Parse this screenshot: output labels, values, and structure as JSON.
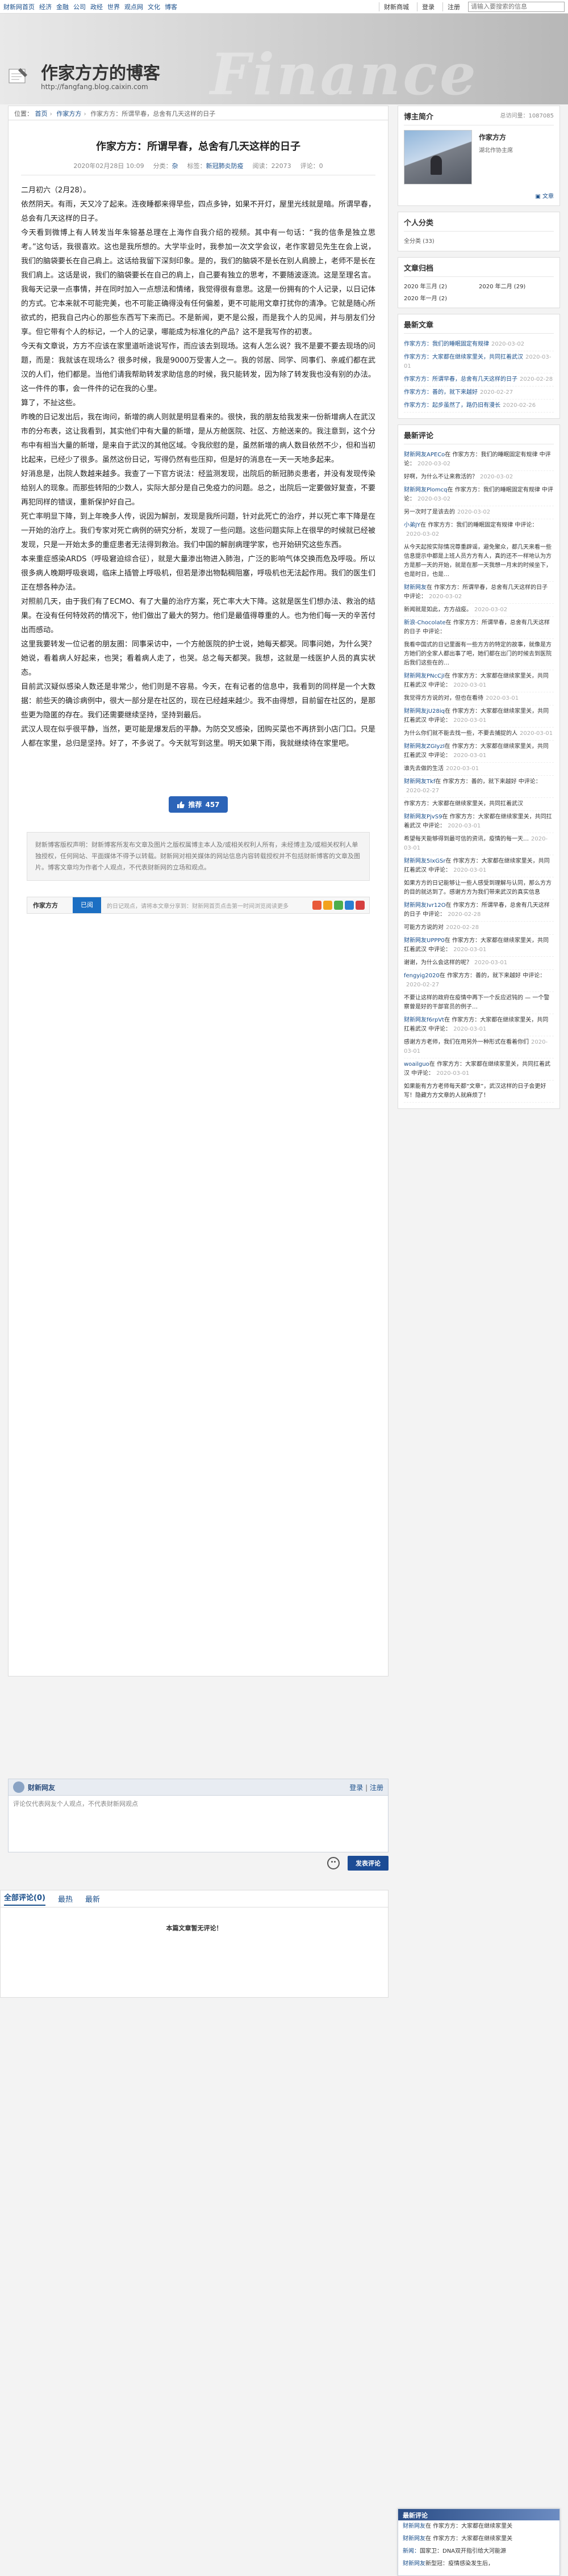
{
  "topbar": {
    "nav": [
      "财新网首页",
      "经济",
      "金融",
      "公司",
      "政经",
      "世界",
      "观点网",
      "文化",
      "博客"
    ],
    "links": [
      "财新商城",
      "登录",
      "注册"
    ],
    "search_placeholder": "请输入要搜索的信息"
  },
  "header": {
    "title": "作家方方的博客",
    "url": "http://fangfang.blog.caixin.com",
    "bg_word": "Finance World"
  },
  "breadcrumb": {
    "items": [
      "位置：",
      "首页",
      "作家方方",
      "作家方方：所谓早春，总舍有几天这样的日子"
    ]
  },
  "article": {
    "title": "作家方方：所谓早春，总舍有几天这样的日子",
    "date": "2020年02月28日 10:09",
    "category_label": "分类：",
    "category": "杂",
    "tag_label": "标签：",
    "tag": "新冠肺炎防疫",
    "views_label": "阅读：",
    "views": "22073",
    "comments_label": "评论：",
    "comments": "0",
    "paragraphs": [
      "二月初六（2月28）。",
      "依然阴天。有雨，天又冷了起来。连夜睡都来得早些，四点多钟，如果不开灯，屋里光线就是暗。所谓早春，总会有几天这样的日子。",
      "今天看到微博上有人转发当年朱镕基总理在上海作自我介绍的视频。其中有一句话：“我的信条是独立思考。”这句话，我很喜欢。这也是我所想的。大学毕业时，我参加一次文学会议，老作家碧见先生在会上说，我们的脑袋要长在自己肩上。这话给我留下深刻印象。是的，我们的脑袋不是长在别人肩膀上，老师不是长在我们肩上。这话是说，我们的脑袋要长在自己的肩上，自己要有独立的思考，不要随波逐流。这是至理名言。",
      "我每天记录一点事情，并在同时加入一点想法和情绪，我觉得很有意思。这是一份拥有的个人记录，以日记体的方式。它本来就不可能完美，也不可能正确得没有任何偏差，更不可能用文章打扰你的清净。它就是随心所欲式的，把我自己内心的那些东西写下来而已。不是新闻，更不是公报，而是我个人的见闻，并与朋友们分享。但它带有个人的标记，一个人的记录，哪能成为标准化的产品？这不是我写作的初衷。",
      "今天有文章说，方方不应该在家里道听途说写作，而应该去到现场。这有人怎么说？我不是要不要去现场的问题，而是：我就该在现场么？很多时候，我是9000万受害人之一。我的邻居、同学、同事们、亲戚们都在武汉的人们，他们都是。当他们请我帮助转发求助信息的时候，我只能转发，因为除了转发我也没有别的办法。这一件件的事，会一件件的记在我的心里。",
      "算了，不扯这些。",
      "昨晚的日记发出后，我在询问，新增的病人则就是明显看来的。很快，我的朋友给我发来一份新增病人在武汉市的分布表，这让我看到，其实他们中有大量的新增，是从方舱医院、社区、方舱送来的。我注意到，这个分布中有相当大量的新增，是来自于武汉的其他区域。令我欣慰的是，虽然新增的病人数目依然不少，但和当初比起来，已经少了很多。虽然这份日记，写得仍然有些压抑，但是好的消息在一天一天地多起来。",
      "好消息是，出院人数越来越多。我查了一下官方说法：经监测发现，出院后的新冠肺炎患者，并没有发现传染给别人的现象。而那些转阳的少数人，实际大部分是自己免疫力的问题。总之，出院后一定要做好复查，不要再犯同样的错误，重新保护好自己。",
      "死亡率明显下降，到上年晚多人传，说因为解剖，发现是我所问题，针对此死亡的治疗，并以死亡率下降是在一开始的治疗上。我们专家对死亡病例的研究分析，发现了一些问题。这些问题实际上在很早的时候就已经被发现，只是一开始太多的重症患者无法得到救治。我们中国的解剖病理学家，也开始研究这些东西。",
      "本来重症感染ARDS（呼吸窘迫综合征），就是大量渗出物进入肺泡，广泛的影响气体交换而危及呼吸。所以很多病人晚期呼吸衰竭，临床上插管上呼吸机，但若是渗出物黏稠阻塞，呼吸机也无法起作用。我们的医生们正在想各种办法。",
      "对照前几天，由于我们有了ECMO、有了大量的治疗方案，死亡率大大下降。这就是医生们想办法、救治的结果。在没有任何特效药的情况下，他们做出了最大的努力。他们是最值得尊重的人。也为他们每一天的辛苦付出而感动。",
      "这里我要转发一位记者的朋友圈：同事采访中，一个方舱医院的护士说，她每天都哭。同事问她，为什么哭？她说，看着病人好起来，也哭；看着病人走了，也哭。总之每天都哭。我想，这就是一线医护人员的真实状态。",
      "目前武汉疑似感染人数还是非常少，他们则是不容易。今天，在有记者的信息中，我看到的同样是一个大数据：前些天的确诊病例中，很大一部分是在社区的，现在已经越来越少。我不由得想，目前留在社区的，是那些更为隐匿的存在。我们还需要继续坚持，坚持到最后。",
      "武汉人现在似乎很平静，当然，更可能是爆发后的平静。为防交叉感染，团购买菜也不再挤到小店门口。只是人都在家里，总归是坚持。好了，不多说了。今天就写到这里。明天如果下雨，我就继续待在家里吧。"
    ]
  },
  "recommend": {
    "label": "推荐",
    "count": "457"
  },
  "disclaimer": "财新博客版权声明：财新博客所发布文章及图片之版权属博主本人及/或相关权利人所有，未经博主及/或相关权利人单独授权，任何网站、平面媒体不得予以转载。财新网对相关媒体的网站信息内容转载授权并不包括财新博客的文章及图片。博客文章均为作者个人观点，不代表财新网的立场和观点。",
  "tagbar": {
    "author": "作家方方",
    "tag": "已阅",
    "tip": "的日记观点，请将本文章分享到：财新网首页点击第一时间浏览阅读更多",
    "share_colors": [
      "#e85a3a",
      "#f2a21d",
      "#4cae4c",
      "#2b7fd3",
      "#d53f3f"
    ]
  },
  "comment_box": {
    "title": "财新网友",
    "login_prefix": "",
    "login": "登录",
    "register": "注册",
    "placeholder": "评论仅代表网友个人观点，不代表财新网观点",
    "publish": "发表评论"
  },
  "comments": {
    "tabs": [
      "全部评论(0)",
      "最热",
      "最新"
    ],
    "empty": "本篇文章暂无评论！"
  },
  "sidebar": {
    "profile": {
      "title": "博主简介",
      "visits_label": "总访问量：",
      "visits": "1087085",
      "name": "作家方方",
      "desc": "湖北作协主席",
      "follow": "文章"
    },
    "person": {
      "title": "个人分类",
      "item": "全分类 (33)"
    },
    "archive": {
      "title": "文章归档",
      "items": [
        "2020 年三月 (2)",
        "2020 年二月 (29)",
        "2020 年一月 (2)"
      ]
    },
    "latest": {
      "title": "最新文章",
      "items": [
        {
          "text": "作家方方：我们的睡眠固定有规律",
          "date": "2020-03-02"
        },
        {
          "text": "作家方方：大家都在继续家里关，共同扛着武汉",
          "date": "2020-03-01"
        },
        {
          "text": "作家方方：所谓早春，总舍有几天这样的日子",
          "date": "2020-02-28"
        },
        {
          "text": "作家方方：善的，就下来越好",
          "date": "2020-02-27"
        },
        {
          "text": "作家方方：起步虽然了，路仍旧有漫长",
          "date": "2020-02-26"
        }
      ]
    },
    "recent_comments": {
      "title": "最新评论",
      "items": [
        {
          "who": "财新网友APECo",
          "text": "在 作家方方：我们的睡眠固定有规律 中评论：",
          "date": "2020-03-02"
        },
        {
          "who": "",
          "text": "好啊，为什么不让来救活的？",
          "date": "2020-03-02"
        },
        {
          "who": "财新网友Plomcq",
          "text": "在 作家方方：我们的睡眠固定有规律 中评论：",
          "date": "2020-03-02"
        },
        {
          "who": "",
          "text": "另一次时了是该去的",
          "date": "2020-03-02"
        },
        {
          "who": "小弟JY",
          "text": "在 作家方方：我们的睡眠固定有规律 中评论：",
          "date": "2020-03-02"
        },
        {
          "who": "",
          "text": "从今天起按实际情况尊重辟谣，避免聚众，都几天来看一些信息提示中都是上班人员方方有人，真的还不一样地认为方方是那一天的开始，就是在那一天我想一月末的时候坐下，也是时日，也是…",
          "date": ""
        },
        {
          "who": "财新网友",
          "text": "在 作家方方：所谓早春，总舍有几天这样的日子 中评论：",
          "date": "2020-03-02"
        },
        {
          "who": "",
          "text": "新闻就是如此，方方战疫。",
          "date": "2020-03-02"
        },
        {
          "who": "新浪-Chocolate",
          "text": "在 作家方方：所谓早春，总舍有几天这样的日子 中评论：",
          "date": ""
        },
        {
          "who": "",
          "text": "我看中国式的日记里面有一些方方的特定的故事，就像是方方她们的全家人都出事了吧，她们都在出门的时候去到医院后我们这些在的…",
          "date": ""
        },
        {
          "who": "财新网友PNcCjI",
          "text": "在 作家方方：大家都在继续家里关，共同扛着武汉 中评论：",
          "date": "2020-03-01"
        },
        {
          "who": "",
          "text": "我觉得方方说的对，但也在看待",
          "date": "2020-03-01"
        },
        {
          "who": "财新网友jU28iq",
          "text": "在 作家方方：大家都在继续家里关，共同扛着武汉 中评论：",
          "date": "2020-03-01"
        },
        {
          "who": "",
          "text": "为什么你们就不能去找一些，不要去捕捉的人",
          "date": "2020-03-01"
        },
        {
          "who": "财新网友ZGIyzI",
          "text": "在 作家方方：大家都在继续家里关，共同扛着武汉 中评论：",
          "date": "2020-03-01"
        },
        {
          "who": "",
          "text": "谁先去做的生活",
          "date": "2020-03-01"
        },
        {
          "who": "财新网友Tkf",
          "text": "在 作家方方：善的，就下来越好 中评论：",
          "date": "2020-02-27"
        },
        {
          "who": "",
          "text": "作家方方：大家都在继续家里关，共同扛着武汉",
          "date": ""
        },
        {
          "who": "财新网友PjvS9",
          "text": "在 作家方方：大家都在继续家里关，共同扛着武汉 中评论：",
          "date": "2020-03-01"
        },
        {
          "who": "",
          "text": "希望每天能够得到最可信的资讯，疫情的每一天…",
          "date": "2020-03-01"
        },
        {
          "who": "财新网友5IxGSr",
          "text": "在 作家方方：大家都在继续家里关，共同扛着武汉 中评论：",
          "date": "2020-03-01"
        },
        {
          "who": "",
          "text": "如果方方的日记能够让一些人感受到理解与认同，那么方方的目的就达到了。感谢方方为我们带来武汉的真实信息",
          "date": ""
        },
        {
          "who": "财新网友Ivr12O",
          "text": "在 作家方方：所谓早春，总舍有几天这样的日子 中评论：",
          "date": "2020-02-28"
        },
        {
          "who": "",
          "text": "可能方方说的对",
          "date": "2020-02-28"
        },
        {
          "who": "财新网友UPPP0",
          "text": "在 作家方方：大家都在继续家里关，共同扛着武汉 中评论：",
          "date": "2020-03-01"
        },
        {
          "who": "",
          "text": "谢谢，为什么会这样的呢？",
          "date": "2020-03-01"
        },
        {
          "who": "fengyig2020",
          "text": "在 作家方方：善的，就下来越好 中评论：",
          "date": "2020-02-27"
        },
        {
          "who": "",
          "text": "不要让这样的政府在疫情中再下一个反应迟钝的 — 一个警察曾是好的干部官员的例子…",
          "date": ""
        },
        {
          "who": "财新网友f6rpVt",
          "text": "在 作家方方：大家都在继续家里关，共同扛着武汉 中评论：",
          "date": "2020-03-01"
        },
        {
          "who": "",
          "text": "感谢方方老师，我们在用另外一种形式在看着你们",
          "date": "2020-03-01"
        },
        {
          "who": "woailguo",
          "text": "在 作家方方：大家都在继续家里关，共同扛着武汉 中评论：",
          "date": "2020-03-01"
        },
        {
          "who": "",
          "text": "如果能有方方老师每天都“文章”，武汉这样的日子会更好写！隐藏方方文章的人就麻烦了！",
          "date": ""
        }
      ]
    }
  },
  "floating": {
    "title": "最新评论",
    "items": [
      {
        "who": "财新网友",
        "text": "在 作家方方：大家都在继续家里关"
      },
      {
        "who": "财新网友",
        "text": "在 作家方方：大家都在继续家里关"
      },
      {
        "who": "新闻：",
        "text": "国家卫：DNA双开指引给大河能源"
      },
      {
        "who": "财新网友",
        "text": "新型冠：疫情感染发生后，"
      }
    ]
  }
}
